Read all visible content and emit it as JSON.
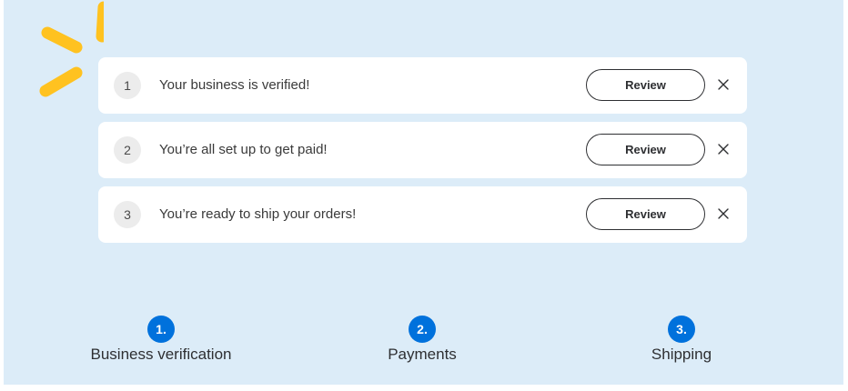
{
  "brand": {
    "spark_color": "#ffc220",
    "logo_name": "spark-logo"
  },
  "tasks": [
    {
      "number": "1",
      "message": "Your business is verified!",
      "button": "Review"
    },
    {
      "number": "2",
      "message": "You’re all set up to get paid!",
      "button": "Review"
    },
    {
      "number": "3",
      "message": "You’re ready to ship your orders!",
      "button": "Review"
    }
  ],
  "steps": [
    {
      "number": "1.",
      "label": "Business verification"
    },
    {
      "number": "2.",
      "label": "Payments"
    },
    {
      "number": "3.",
      "label": "Shipping"
    }
  ],
  "colors": {
    "panel_background": "#dcecf8",
    "step_badge": "#0071dc",
    "card_background": "#ffffff"
  }
}
